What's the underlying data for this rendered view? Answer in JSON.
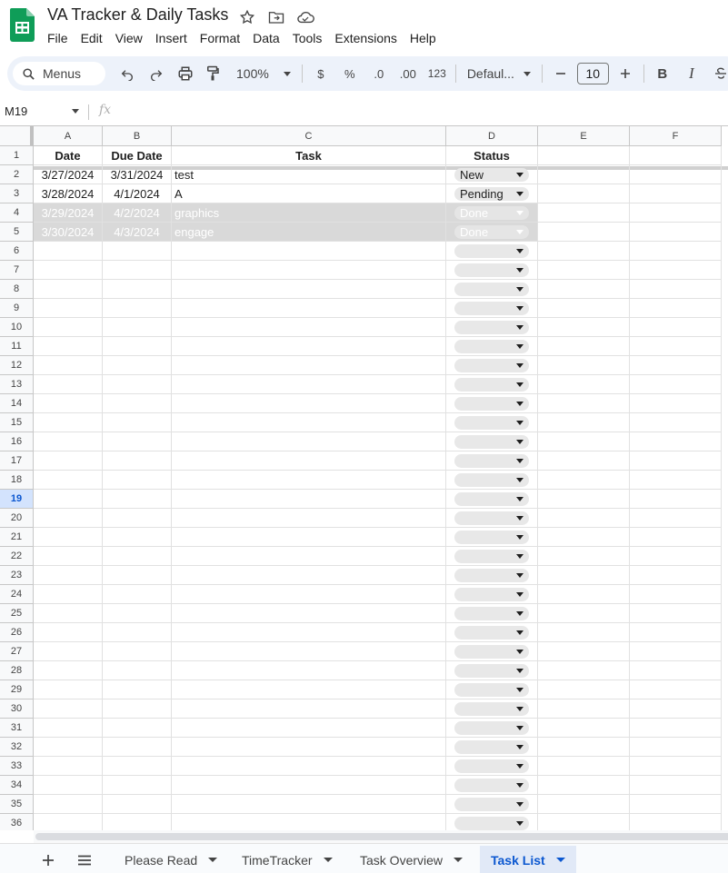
{
  "doc": {
    "title": "VA Tracker & Daily Tasks"
  },
  "menu": [
    "File",
    "Edit",
    "View",
    "Insert",
    "Format",
    "Data",
    "Tools",
    "Extensions",
    "Help"
  ],
  "toolbar": {
    "search_label": "Menus",
    "zoom": "100%",
    "currency": "$",
    "percent": "%",
    "decrease_decimal": ".0",
    "increase_decimal": ".00",
    "number_format": "123",
    "font": "Defaul...",
    "font_size": "10",
    "bold": "B",
    "italic": "I"
  },
  "formula": {
    "cell_ref": "M19",
    "fx": "fx",
    "value": ""
  },
  "columns": [
    "A",
    "B",
    "C",
    "D",
    "E",
    "F"
  ],
  "headers": {
    "a": "Date",
    "b": "Due Date",
    "c": "Task",
    "d": "Status"
  },
  "rows": [
    {
      "num": "2",
      "date": "3/27/2024",
      "due": "3/31/2024",
      "task": "test",
      "status": "New",
      "done": false
    },
    {
      "num": "3",
      "date": "3/28/2024",
      "due": "4/1/2024",
      "task": "A",
      "status": "Pending",
      "done": false
    },
    {
      "num": "4",
      "date": "3/29/2024",
      "due": "4/2/2024",
      "task": "graphics",
      "status": "Done",
      "done": true
    },
    {
      "num": "5",
      "date": "3/30/2024",
      "due": "4/3/2024",
      "task": "engage",
      "status": "Done",
      "done": true
    }
  ],
  "empty_row_numbers": [
    "6",
    "7",
    "8",
    "9",
    "10",
    "11",
    "12",
    "13",
    "14",
    "15",
    "16",
    "17",
    "18",
    "19",
    "20",
    "21",
    "22",
    "23",
    "24",
    "25",
    "26",
    "27",
    "28",
    "29",
    "30",
    "31",
    "32",
    "33",
    "34",
    "35",
    "36"
  ],
  "active_row": "19",
  "sheets": [
    {
      "label": "Please Read",
      "active": false
    },
    {
      "label": "TimeTracker",
      "active": false
    },
    {
      "label": "Task Overview",
      "active": false
    },
    {
      "label": "Task List",
      "active": true
    }
  ],
  "colors": {
    "accent": "#0b57d0",
    "sheets_green": "#0f9d58",
    "done_fill": "#d9d9d9",
    "toolbar_bg": "#edf2fa"
  }
}
